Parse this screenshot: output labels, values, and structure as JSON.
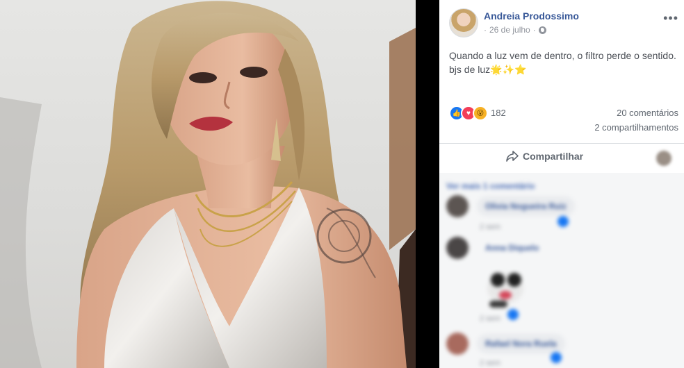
{
  "post": {
    "author": "Andreia Prodossimo",
    "date": "26 de julho",
    "separator": "·",
    "more_icon": "more-horizontal-icon",
    "more_glyph": "•••",
    "privacy_icon": "globe-icon",
    "text_line1": "Quando a luz vem de dentro, o filtro perde o sentido.",
    "text_line2": "bjs de luz🌟✨⭐"
  },
  "reactions": {
    "icons": [
      "like-icon",
      "love-icon",
      "wow-icon"
    ],
    "like_glyph": "👍",
    "love_glyph": "♥",
    "wow_glyph": "😮",
    "count": "182",
    "comments": "20 comentários",
    "shares": "2 compartilhamentos"
  },
  "actions": {
    "share_label": "Compartilhar",
    "share_icon": "share-arrow-icon"
  },
  "comments": {
    "view_more": "Ver mais 1 comentário",
    "items": [
      {
        "name": "Olivia Nogueira Ruiz",
        "time": "2 sem"
      },
      {
        "name": "Anna Diquelo",
        "time": "2 sem"
      },
      {
        "name": "Rafael Nora Ruela",
        "time": "2 sem"
      }
    ]
  },
  "colors": {
    "link_blue": "#385898",
    "text_gray": "#606770",
    "like_blue": "#1877f2",
    "love_red": "#f33e58",
    "wow_yellow": "#f7b125"
  }
}
